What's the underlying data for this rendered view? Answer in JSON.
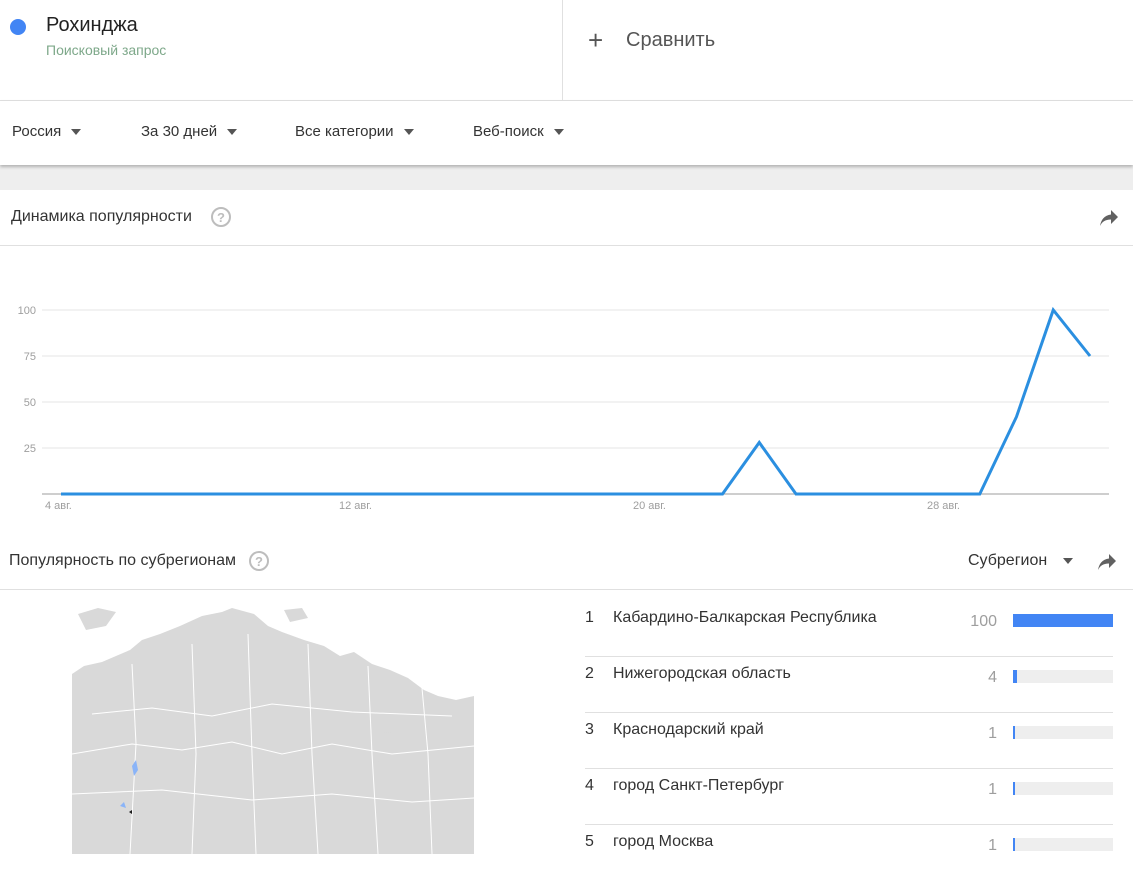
{
  "term": {
    "name": "Рохинджа",
    "subtitle": "Поисковый запрос",
    "color": "#4285f4"
  },
  "compare": {
    "label": "Сравнить"
  },
  "filters": [
    {
      "label": "Россия"
    },
    {
      "label": "За 30 дней"
    },
    {
      "label": "Все категории"
    },
    {
      "label": "Веб-поиск"
    }
  ],
  "interest_over_time": {
    "title": "Динамика популярности"
  },
  "chart_data": {
    "type": "line",
    "x": [
      "4 авг.",
      "5 авг.",
      "6 авг.",
      "7 авг.",
      "8 авг.",
      "9 авг.",
      "10 авг.",
      "11 авг.",
      "12 авг.",
      "13 авг.",
      "14 авг.",
      "15 авг.",
      "16 авг.",
      "17 авг.",
      "18 авг.",
      "19 авг.",
      "20 авг.",
      "21 авг.",
      "22 авг.",
      "23 авг.",
      "24 авг.",
      "25 авг.",
      "26 авг.",
      "27 авг.",
      "28 авг.",
      "29 авг.",
      "30 авг.",
      "31 авг.",
      "1 сент.",
      "2 сент."
    ],
    "series": [
      {
        "values": [
          0,
          0,
          0,
          0,
          0,
          0,
          0,
          0,
          0,
          0,
          0,
          0,
          0,
          0,
          0,
          0,
          0,
          0,
          0,
          28,
          0,
          0,
          0,
          0,
          0,
          0,
          42,
          100,
          75
        ]
      }
    ],
    "x_tick_labels": [
      "4 авг.",
      "12 авг.",
      "20 авг.",
      "28 авг."
    ],
    "y_tick_labels": [
      "25",
      "50",
      "75",
      "100"
    ],
    "ylim": [
      0,
      100
    ],
    "grid": true,
    "line_color": "#2b8fe0"
  },
  "by_subregion": {
    "title": "Популярность по субрегионам",
    "dropdown_label": "Субрегион",
    "rows": [
      {
        "rank": "1",
        "name": "Кабардино-Балкарская Республика",
        "value": "100",
        "fraction": 1.0
      },
      {
        "rank": "2",
        "name": "Нижегородская область",
        "value": "4",
        "fraction": 0.04
      },
      {
        "rank": "3",
        "name": "Краснодарский край",
        "value": "1",
        "fraction": 0.01
      },
      {
        "rank": "4",
        "name": "город Санкт-Петербург",
        "value": "1",
        "fraction": 0.01
      },
      {
        "rank": "5",
        "name": "город Москва",
        "value": "1",
        "fraction": 0.01
      }
    ]
  },
  "icons": {
    "help": "help-circle-icon",
    "share": "share-arrow-icon",
    "dropdown": "caret-down-icon",
    "add": "plus-icon"
  }
}
